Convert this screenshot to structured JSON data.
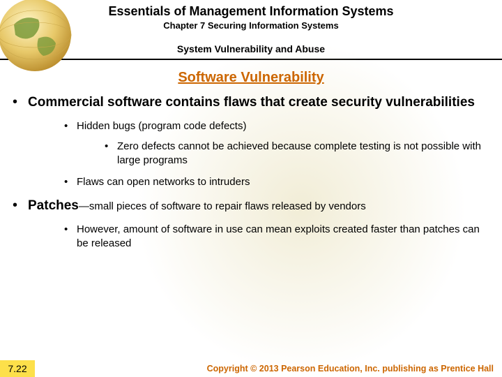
{
  "header": {
    "title": "Essentials of Management Information Systems",
    "chapter": "Chapter 7 Securing Information Systems",
    "section": "System Vulnerability and Abuse"
  },
  "topic": "Software Vulnerability",
  "bullets": {
    "b1": "Commercial software contains flaws that create security vulnerabilities",
    "b1_1": "Hidden bugs (program code defects)",
    "b1_1_1": "Zero defects cannot be achieved because complete testing is not possible with large programs",
    "b1_2": "Flaws can open networks to intruders",
    "b2_bold": "Patches",
    "b2_rest": "—small pieces of software to repair flaws released by vendors",
    "b2_1": "However, amount of software in use can mean exploits created faster than patches can be released"
  },
  "footer": {
    "slide_number": "7.22",
    "copyright": "Copyright © 2013 Pearson Education, Inc. publishing as Prentice Hall"
  }
}
